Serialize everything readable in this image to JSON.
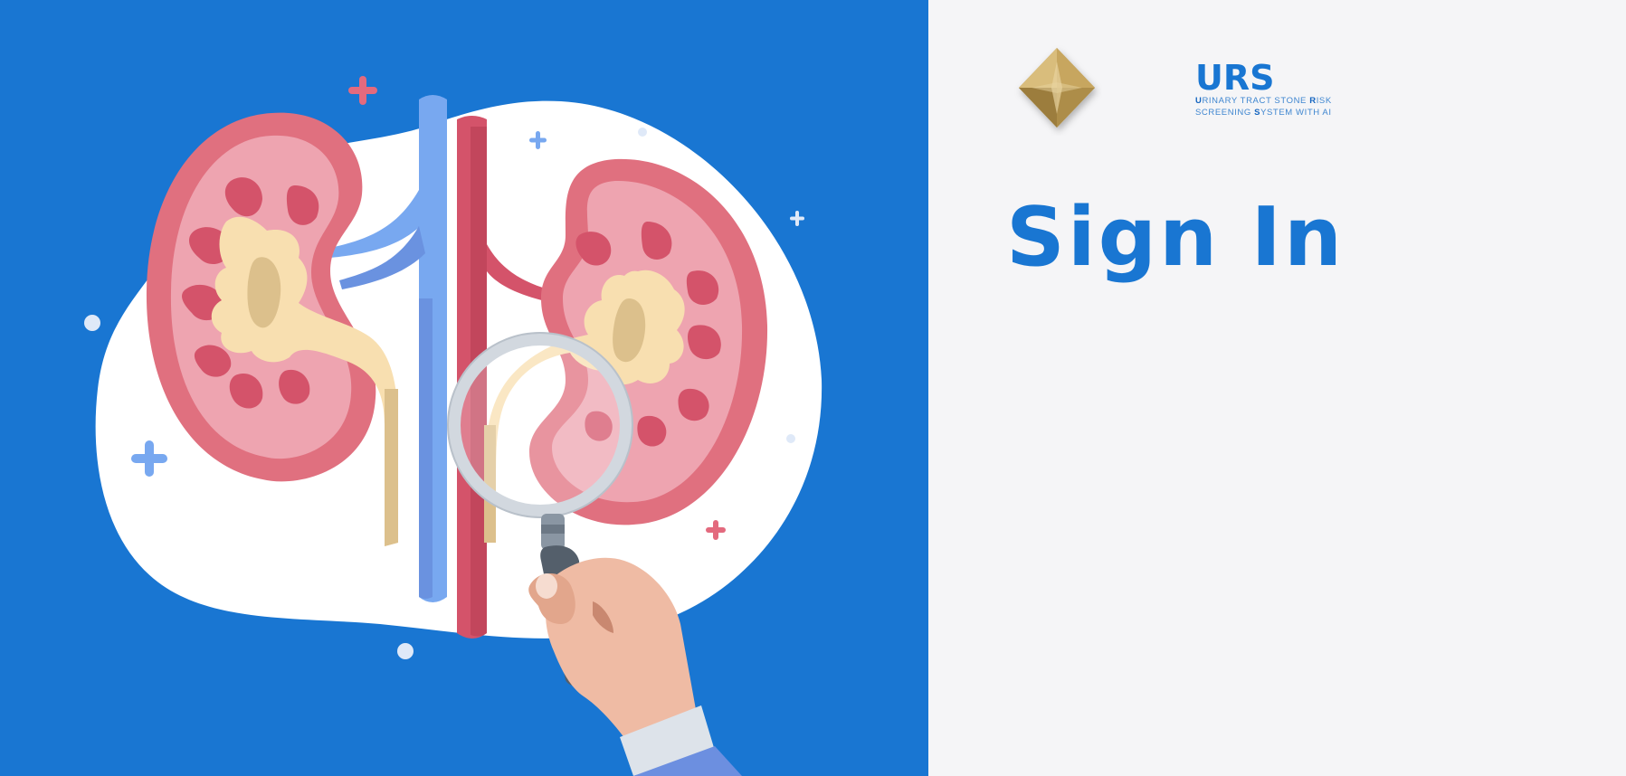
{
  "hero": {
    "colors": {
      "background": "#1976d2",
      "blob": "#ffffff",
      "kidney": "#e0707f",
      "vein": "#78a8f0",
      "artery": "#d4536a",
      "pelvis": "#f8dfb0"
    },
    "icons": [
      "kidneys-illustration",
      "magnifying-glass-icon",
      "hand-icon",
      "plus-icon"
    ]
  },
  "brand": {
    "name": "URS",
    "lines": [
      [
        {
          "initial": "U",
          "rest": "RINARY TRACT STONE "
        },
        {
          "initial": "R",
          "rest": "ISK"
        }
      ],
      [
        {
          "initial": "",
          "rest": "SCREENING "
        },
        {
          "initial": "S",
          "rest": "YSTEM WITH AI"
        }
      ]
    ],
    "line1_a_initial": "U",
    "line1_a_rest": "RINARY TRACT STONE ",
    "line1_b_initial": "R",
    "line1_b_rest": "ISK",
    "line2_a_rest": "SCREENING ",
    "line2_b_initial": "S",
    "line2_b_rest": "YSTEM WITH AI",
    "accent_color": "#1976d2",
    "logo_color": "#b8974f",
    "logo_icon": "diamond-logo-icon"
  },
  "form": {
    "title": "Sign In"
  }
}
